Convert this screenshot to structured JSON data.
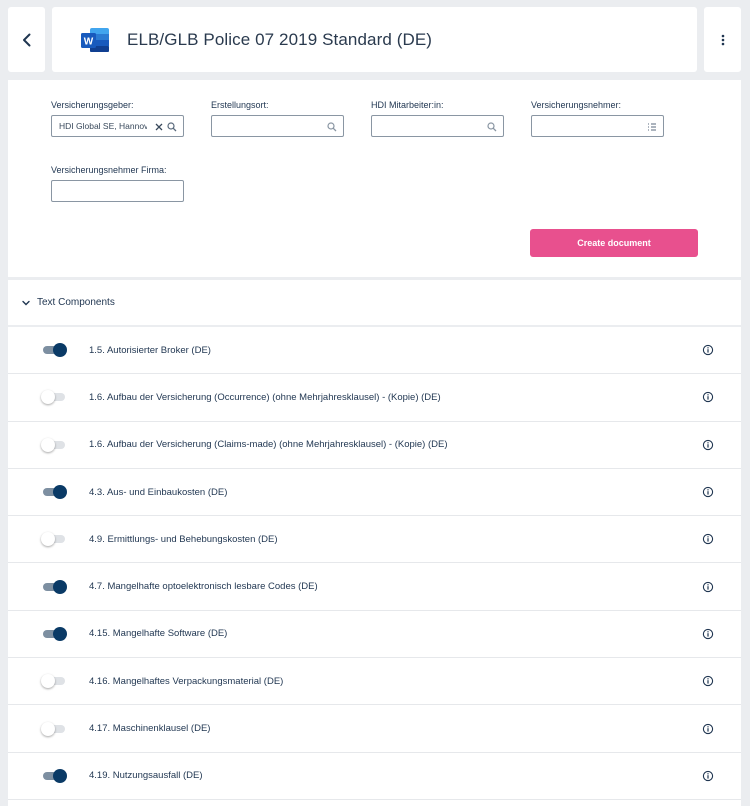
{
  "header": {
    "title": "ELB/GLB Police 07 2019 Standard (DE)",
    "icons": {
      "back": "chevron-left-icon",
      "doc": "word-icon",
      "menu": "more-vertical-icon"
    },
    "word_blue": "#185abd"
  },
  "form": {
    "fields": [
      {
        "label": "Versicherungsgeber:",
        "value": "HDI Global SE, Hannover",
        "icons": [
          "clear-icon",
          "search-icon"
        ]
      },
      {
        "label": "Erstellungsort:",
        "value": "",
        "icons": [
          "search-icon"
        ]
      },
      {
        "label": "HDI Mitarbeiter:in:",
        "value": "",
        "icons": [
          "search-icon"
        ]
      },
      {
        "label": "Versicherungsnehmer:",
        "value": "",
        "icons": [
          "list-icon"
        ]
      },
      {
        "label": "Versicherungsnehmer Firma:",
        "value": ""
      }
    ],
    "create_label": "Create document",
    "accent": "#e8508e"
  },
  "section": {
    "label": "Text Components",
    "expanded": true
  },
  "components": [
    {
      "label": "1.5. Autorisierter Broker (DE)",
      "on": true
    },
    {
      "label": "1.6. Aufbau der Versicherung (Occurrence) (ohne Mehrjahresklausel) - (Kopie) (DE)",
      "on": false
    },
    {
      "label": "1.6. Aufbau der Versicherung (Claims-made) (ohne Mehrjahresklausel) - (Kopie) (DE)",
      "on": false
    },
    {
      "label": "4.3. Aus- und Einbaukosten (DE)",
      "on": true
    },
    {
      "label": "4.9. Ermittlungs- und Behebungskosten (DE)",
      "on": false
    },
    {
      "label": "4.7. Mangelhafte optoelektronisch lesbare Codes (DE)",
      "on": true
    },
    {
      "label": "4.15. Mangelhafte Software (DE)",
      "on": true
    },
    {
      "label": "4.16. Mangelhaftes Verpackungsmaterial (DE)",
      "on": false
    },
    {
      "label": "4.17. Maschinenklausel (DE)",
      "on": false
    },
    {
      "label": "4.19. Nutzungsausfall (DE)",
      "on": true
    }
  ]
}
